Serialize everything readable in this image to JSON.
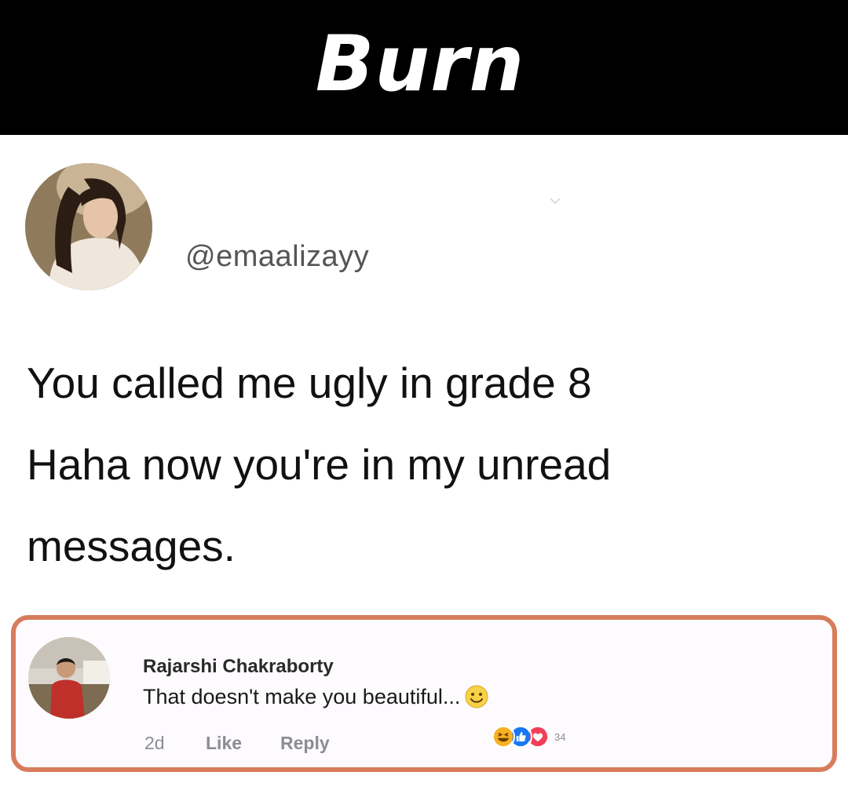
{
  "banner": {
    "title": "Burn"
  },
  "post": {
    "handle": "@emaalizayy",
    "text_lines": [
      "You called me ugly in grade 8",
      "Haha now you're in my unread",
      "messages."
    ]
  },
  "comment": {
    "author": "Rajarshi Chakraborty",
    "text": "That doesn't make you beautiful...",
    "text_emoji": "smile-emoji",
    "time": "2d",
    "like_label": "Like",
    "reply_label": "Reply",
    "reactions": [
      "haha-emoji",
      "like-emoji",
      "love-emoji"
    ],
    "reaction_count": "34"
  },
  "colors": {
    "banner_bg": "#000000",
    "highlight_border": "#d77c5c",
    "reaction_like": "#1877f2",
    "reaction_love": "#f33e58",
    "reaction_haha": "#f7b125"
  }
}
